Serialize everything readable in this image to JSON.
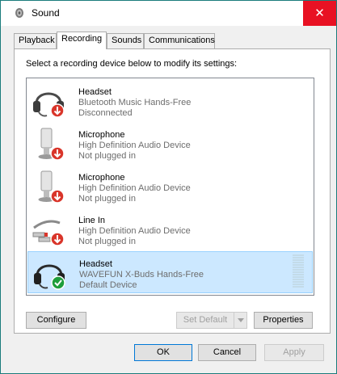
{
  "window": {
    "title": "Sound",
    "close_symbol": "✕"
  },
  "tabs": [
    {
      "label": "Playback",
      "active": false
    },
    {
      "label": "Recording",
      "active": true
    },
    {
      "label": "Sounds",
      "active": false
    },
    {
      "label": "Communications",
      "active": false
    }
  ],
  "panel": {
    "instruction": "Select a recording device below to modify its settings:"
  },
  "devices": [
    {
      "name": "Headset",
      "description": "Bluetooth Music Hands-Free",
      "status": "Disconnected",
      "icon": "headset-icon",
      "badge": "red-down-arrow",
      "selected": false
    },
    {
      "name": "Microphone",
      "description": "High Definition Audio Device",
      "status": "Not plugged in",
      "icon": "microphone-icon",
      "badge": "red-down-arrow",
      "selected": false
    },
    {
      "name": "Microphone",
      "description": "High Definition Audio Device",
      "status": "Not plugged in",
      "icon": "microphone-icon",
      "badge": "red-down-arrow",
      "selected": false
    },
    {
      "name": "Line In",
      "description": "High Definition Audio Device",
      "status": "Not plugged in",
      "icon": "line-in-cable-icon",
      "badge": "red-down-arrow",
      "selected": false
    },
    {
      "name": "Headset",
      "description": "WAVEFUN X-Buds Hands-Free",
      "status": "Default Device",
      "icon": "headset-icon",
      "badge": "green-check",
      "selected": true
    }
  ],
  "buttons": {
    "configure": "Configure",
    "set_default": "Set Default",
    "properties": "Properties",
    "ok": "OK",
    "cancel": "Cancel",
    "apply": "Apply"
  },
  "colors": {
    "selection": "#cce8ff",
    "close": "#e81123",
    "badge_red": "#d9352a",
    "badge_green": "#1e9e3a"
  }
}
